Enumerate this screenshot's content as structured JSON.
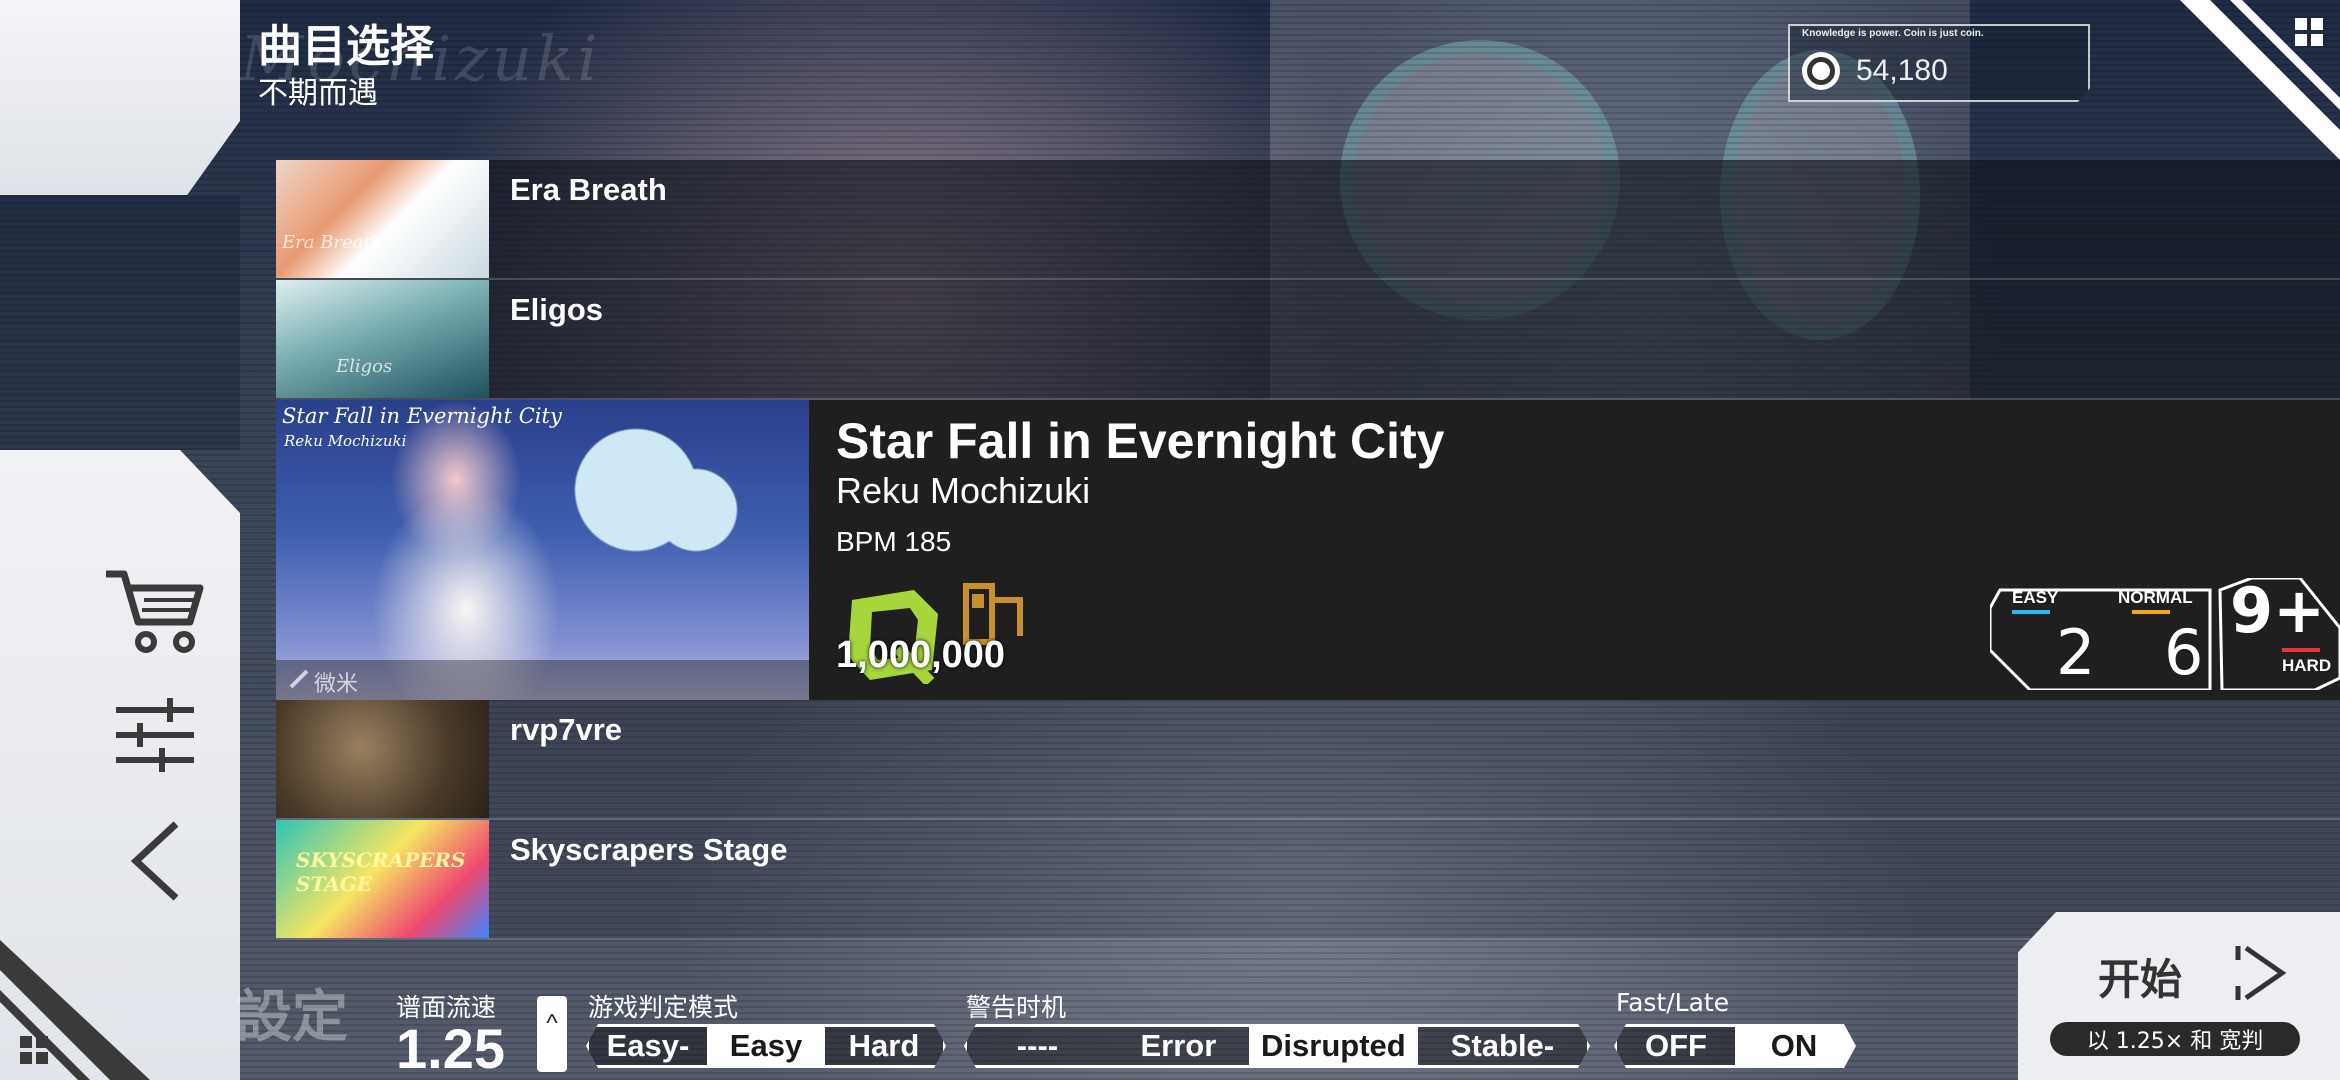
{
  "header": {
    "title": "曲目选择",
    "subtitle": "不期而遇",
    "bg_title": "Mochizuki"
  },
  "coins": {
    "tagline": "Knowledge is power. Coin is just coin.",
    "value": "54,180"
  },
  "songs": [
    {
      "name": "Era Breath",
      "thumb_text": "Era Breath"
    },
    {
      "name": "Eligos",
      "thumb_text": "Eligos"
    },
    {
      "name": "rvp7vre",
      "thumb_text": ""
    },
    {
      "name": "Skyscrapers Stage",
      "thumb_text": "SKYSCRAPERS STAGE"
    }
  ],
  "selected": {
    "title": "Star Fall in Evernight City",
    "artist": "Reku Mochizuki",
    "bpm": "BPM 185",
    "art_title": "Star Fall in Evernight City",
    "art_artist": "Reku Mochizuki",
    "illustrator": "微米",
    "score": "1,000,000",
    "rank_color": "#a6d63c",
    "badge_color": "#c9902f",
    "difficulty": {
      "easy_label": "EASY",
      "easy_value": "2",
      "easy_color": "#29b6f6",
      "normal_label": "NORMAL",
      "normal_value": "6",
      "normal_color": "#f5a623",
      "hard_label": "HARD",
      "hard_value": "9+",
      "hard_color": "#e53935"
    }
  },
  "settings": {
    "bg_text": "設定",
    "speed_label": "谱面流速",
    "speed_value": "1.25",
    "speed_up_icon": "^",
    "judge_label": "游戏判定模式",
    "judge_options": [
      "Easy-",
      "Easy",
      "Hard"
    ],
    "judge_active": 1,
    "warning_label": "警告时机",
    "warning_options": [
      "----",
      "Error",
      "Disrupted",
      "Stable-"
    ],
    "warning_active": 2,
    "fastlate_label": "Fast/Late",
    "fastlate_options": [
      "OFF",
      "ON"
    ],
    "fastlate_active": 1
  },
  "start": {
    "label": "开始",
    "sub": "以 1.25× 和 宽判"
  },
  "icons": [
    "cart-icon",
    "sliders-icon",
    "back-icon",
    "grid-icon",
    "coin-icon",
    "play-icon"
  ]
}
